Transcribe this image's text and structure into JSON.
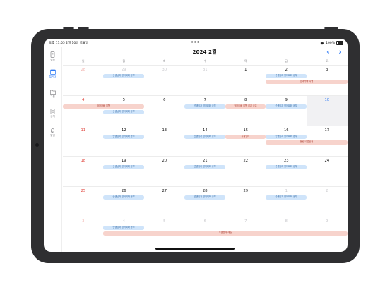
{
  "status": {
    "time": "오후 11:55  2월 10일 토요일",
    "battery": "100%",
    "dots": "•••"
  },
  "sidebar": [
    {
      "label": "설정",
      "icon": "phone-icon"
    },
    {
      "label": "캘린더",
      "icon": "calendar-icon"
    },
    {
      "label": "그룹",
      "icon": "folder-icon"
    },
    {
      "label": "공지",
      "icon": "notice-icon"
    },
    {
      "label": "알림",
      "icon": "bell-icon"
    }
  ],
  "header": {
    "title": "2024 2월",
    "prev": "‹",
    "next": "›"
  },
  "weekdays": [
    "일",
    "월",
    "화",
    "수",
    "목",
    "금",
    "토"
  ],
  "weeks": [
    {
      "days": [
        "28",
        "29",
        "30",
        "31",
        "1",
        "2",
        "3"
      ]
    },
    {
      "days": [
        "4",
        "5",
        "6",
        "7",
        "8",
        "9",
        "10"
      ]
    },
    {
      "days": [
        "11",
        "12",
        "13",
        "14",
        "15",
        "16",
        "17"
      ]
    },
    {
      "days": [
        "18",
        "19",
        "20",
        "21",
        "22",
        "23",
        "24"
      ]
    },
    {
      "days": [
        "25",
        "26",
        "27",
        "28",
        "29",
        "1",
        "2"
      ]
    },
    {
      "days": [
        "3",
        "4",
        "5",
        "6",
        "7",
        "8",
        "9"
      ]
    }
  ],
  "events": {
    "blue_label": "선생님과 영어회화 공부",
    "red": {
      "e1": "엄마아빠 여행",
      "e2": "엄마아빠 여행",
      "e3": "엄마아빠 여행 결과 공유",
      "e4": "우쿨렐레",
      "e5": "볼링 수업신청",
      "e6": "우쿨렐레 레슨"
    }
  },
  "colors": {
    "accent": "#2f7bf6",
    "sunday": "#e0443c",
    "event_blue": "#cfe4fa",
    "event_red": "#f7d3cc"
  }
}
